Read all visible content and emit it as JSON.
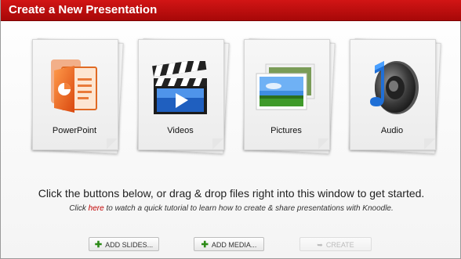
{
  "window": {
    "title": "Create a New Presentation"
  },
  "cards": [
    {
      "label": "PowerPoint",
      "icon": "powerpoint-icon"
    },
    {
      "label": "Videos",
      "icon": "clapperboard-icon"
    },
    {
      "label": "Pictures",
      "icon": "picture-icon"
    },
    {
      "label": "Audio",
      "icon": "speaker-icon"
    }
  ],
  "instructions": {
    "main": "Click the buttons below, or drag & drop files right into this window to get started.",
    "sub_prefix": "Click",
    "sub_link": "here",
    "sub_suffix": "to watch a quick tutorial to learn how to create & share presentations with Knoodle."
  },
  "buttons": {
    "add_slides": "ADD SLIDES...",
    "add_media": "ADD MEDIA...",
    "create": "CREATE"
  },
  "colors": {
    "titlebar": "#c00f0f",
    "link": "#c00000",
    "plus": "#2c8a17"
  }
}
